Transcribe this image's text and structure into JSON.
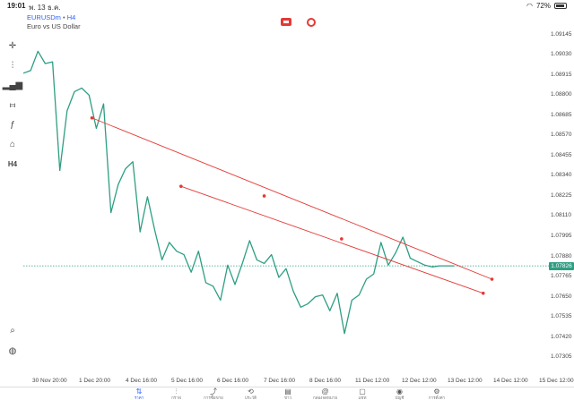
{
  "status_bar": {
    "time": "19:01",
    "date": "พ. 13 ธ.ค.",
    "battery": "72%"
  },
  "chart_header": {
    "symbol": "EURUSDm",
    "timeframe": "H4",
    "description": "Euro vs US Dollar"
  },
  "left_toolbar": [
    {
      "name": "crosshair-icon",
      "glyph": "✛"
    },
    {
      "name": "candlestick-icon",
      "glyph": "⫶"
    },
    {
      "name": "volume-bars-icon",
      "glyph": "▂▄▆"
    },
    {
      "name": "indicators-icon",
      "glyph": "⧦"
    },
    {
      "name": "function-icon",
      "glyph": "ƒ"
    },
    {
      "name": "shapes-icon",
      "glyph": "⌂"
    },
    {
      "name": "timeframe-label",
      "glyph": "H4"
    }
  ],
  "price_axis": [
    "1.09145",
    "1.09030",
    "1.08915",
    "1.08800",
    "1.08685",
    "1.08570",
    "1.08455",
    "1.08340",
    "1.08225",
    "1.08110",
    "1.07995",
    "1.07880",
    "1.07765",
    "1.07650",
    "1.07535",
    "1.07420",
    "1.07305"
  ],
  "current_price": "1.07826",
  "time_axis": [
    "30 Nov 20:00",
    "1 Dec 20:00",
    "4 Dec 16:00",
    "5 Dec 16:00",
    "6 Dec 16:00",
    "7 Dec 16:00",
    "8 Dec 16:00",
    "11 Dec 12:00",
    "12 Dec 12:00",
    "13 Dec 12:00",
    "14 Dec 12:00",
    "15 Dec 12:00"
  ],
  "chart_data": {
    "type": "line",
    "symbol": "EURUSDm",
    "timeframe": "H4",
    "y_range": [
      1.0726,
      1.0922
    ],
    "x_range": [
      0,
      36
    ],
    "series_color": "#2e9e83",
    "series": [
      {
        "x": [
          0,
          0.5,
          1,
          1.5,
          2,
          2.5,
          3,
          3.5,
          4,
          4.5,
          5,
          5.5,
          6,
          6.5,
          7,
          7.5,
          8,
          8.5,
          9,
          9.5,
          10,
          10.5,
          11,
          11.5,
          12,
          12.5,
          13,
          13.5,
          14,
          14.5,
          15,
          15.5,
          16,
          16.5,
          17,
          17.5,
          18,
          18.5,
          19,
          19.5,
          20,
          20.5,
          21,
          21.5,
          22,
          22.5,
          23,
          23.5,
          24,
          24.5,
          25,
          25.5,
          26,
          26.5,
          27,
          27.5,
          28,
          28.5,
          29,
          29.5
        ],
        "y": [
          1.08925,
          1.0894,
          1.0905,
          1.0898,
          1.0899,
          1.0837,
          1.0871,
          1.0882,
          1.0884,
          1.088,
          1.0861,
          1.0875,
          1.0813,
          1.0829,
          1.0838,
          1.0842,
          1.0802,
          1.0822,
          1.0803,
          1.0786,
          1.0796,
          1.0791,
          1.0789,
          1.0779,
          1.0791,
          1.0773,
          1.0771,
          1.0763,
          1.0783,
          1.0772,
          1.0784,
          1.0797,
          1.0786,
          1.0784,
          1.0789,
          1.0776,
          1.0781,
          1.0768,
          1.0759,
          1.0761,
          1.0765,
          1.0766,
          1.0757,
          1.0767,
          1.0744,
          1.0763,
          1.0766,
          1.0775,
          1.0778,
          1.0796,
          1.0783,
          1.079,
          1.0799,
          1.0787,
          1.0785,
          1.0783,
          1.0782,
          1.07826,
          1.07826,
          1.07826
        ]
      }
    ],
    "current_price": 1.07826,
    "trendlines": [
      {
        "color": "#e53935",
        "points": [
          [
            4.7,
            1.0867
          ],
          [
            16.5,
            1.08225
          ],
          [
            32.1,
            1.0775
          ]
        ]
      },
      {
        "color": "#e53935",
        "points": [
          [
            10.8,
            1.0828
          ],
          [
            21.8,
            1.0798
          ],
          [
            31.5,
            1.0767
          ]
        ]
      }
    ]
  },
  "bottom_nav": [
    {
      "label": "ราคา",
      "glyph": "⇅",
      "name": "nav-quotes",
      "active": true
    },
    {
      "label": "กราฟ",
      "glyph": "⫶",
      "name": "nav-chart",
      "active": false
    },
    {
      "label": "การซื้อขาย",
      "glyph": "⤴",
      "name": "nav-trade",
      "active": false
    },
    {
      "label": "ประวัติ",
      "glyph": "⟲",
      "name": "nav-history",
      "active": false
    },
    {
      "label": "ข่าว",
      "glyph": "▤",
      "name": "nav-news",
      "active": false
    },
    {
      "label": "กล่องจดหมาย",
      "glyph": "@",
      "name": "nav-mailbox",
      "active": false
    },
    {
      "label": "แชท",
      "glyph": "▢",
      "name": "nav-chat",
      "active": false
    },
    {
      "label": "บัญชี",
      "glyph": "◉",
      "name": "nav-account",
      "active": false
    },
    {
      "label": "การตั้งค่า",
      "glyph": "⚙",
      "name": "nav-settings",
      "active": false
    }
  ]
}
